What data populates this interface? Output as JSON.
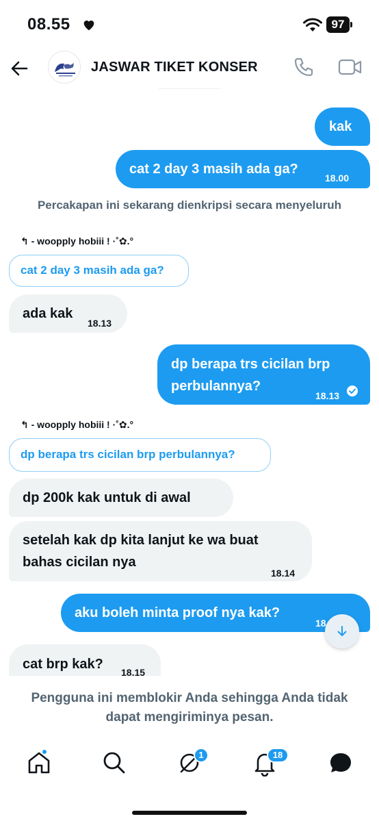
{
  "status": {
    "time": "08.55",
    "battery": "97"
  },
  "header": {
    "title": "JASWAR TIKET KONSER"
  },
  "messages": [
    {
      "text": "kak",
      "time": ""
    },
    {
      "text": "cat 2 day 3 masih ada ga?",
      "time": "18.00"
    },
    {
      "text": "ada kak",
      "time": "18.13"
    },
    {
      "text_line1": "dp berapa trs cicilan brp",
      "text_line2": "perbulannya?",
      "time": "18.13"
    },
    {
      "text": "dp 200k kak untuk di awal",
      "time": ""
    },
    {
      "text_line1": "setelah kak dp kita lanjut ke wa buat",
      "text_line2": "bahas cicilan nya",
      "time": "18.14"
    },
    {
      "text": "aku boleh minta proof nya kak?",
      "time": "18.15"
    },
    {
      "text": "cat brp kak?",
      "time": "18.15"
    }
  ],
  "encryption_notice": "Percakapan ini sekarang dienkripsi secara menyeluruh",
  "replies": [
    {
      "arrow": "↰",
      "label": "- woopply hobiii ! ·˚✿.°",
      "quote": "cat 2 day 3 masih ada ga?"
    },
    {
      "arrow": "↰",
      "label": "- woopply hobiii ! ·˚✿.°",
      "quote": "dp berapa trs cicilan brp perbulannya?"
    }
  ],
  "blocked_notice": "Pengguna ini memblokir Anda sehingga Anda tidak dapat mengiriminya pesan.",
  "nav": {
    "grok_badge": "1",
    "notifications_badge": "18"
  },
  "colors": {
    "accent": "#1d9bf0",
    "incoming_bubble": "#eff3f4",
    "muted_text": "#536471"
  },
  "icons": [
    "heart-icon",
    "wifi-icon",
    "battery-icon",
    "back-arrow-icon",
    "phone-icon",
    "video-camera-icon",
    "read-check-icon",
    "reply-arrow-icon",
    "scroll-down-arrow-icon",
    "home-icon",
    "search-icon",
    "grok-icon",
    "bell-icon",
    "messages-icon"
  ]
}
